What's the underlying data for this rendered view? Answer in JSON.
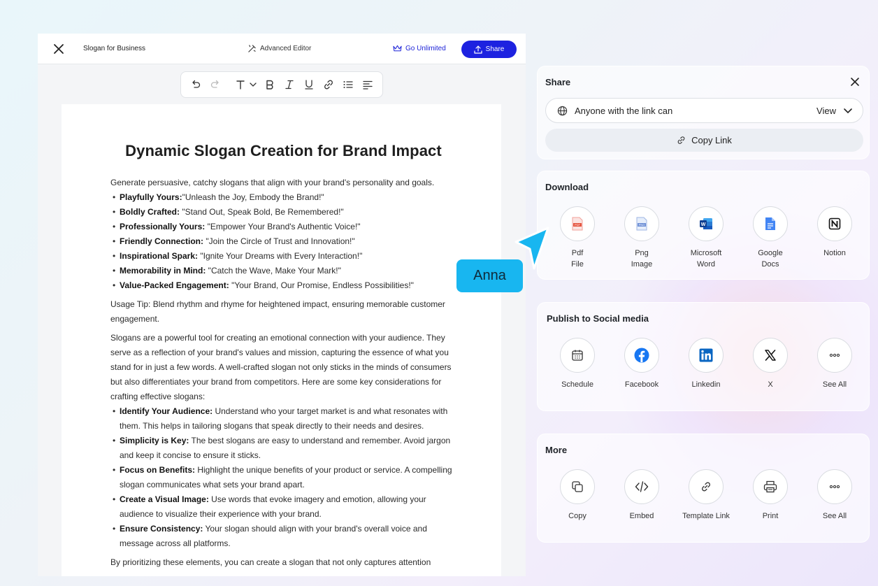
{
  "editor": {
    "doc_title": "Slogan for Business",
    "advanced_editor": "Advanced Editor",
    "go_unlimited": "Go Unlimited",
    "share_label": "Share",
    "toolbar": [
      "undo-icon",
      "redo-icon",
      "text-size-icon",
      "chevron-down-icon",
      "bold-icon",
      "italic-icon",
      "underline-icon",
      "link-icon",
      "list-icon",
      "align-left-icon"
    ]
  },
  "document": {
    "title": "Dynamic Slogan Creation for Brand Impact",
    "intro": "Generate persuasive, catchy slogans that align with your brand's personality and goals.",
    "slogans": [
      {
        "label": "Playfully Yours:",
        "text": "\"Unleash the Joy, Embody the Brand!\""
      },
      {
        "label": "Boldly Crafted:",
        "text": " \"Stand Out, Speak Bold, Be Remembered!\""
      },
      {
        "label": "Professionally Yours:",
        "text": " \"Empower Your Brand's Authentic Voice!\""
      },
      {
        "label": "Friendly Connection:",
        "text": " \"Join the Circle of Trust and Innovation!\""
      },
      {
        "label": "Inspirational Spark:",
        "text": " \"Ignite Your Dreams with Every Interaction!\""
      },
      {
        "label": "Memorability in Mind:",
        "text": " \"Catch the Wave, Make Your Mark!\""
      },
      {
        "label": "Value-Packed Engagement:",
        "text": " \"Your Brand, Our Promise, Endless Possibilities!\""
      }
    ],
    "usage_tip": "Usage Tip: Blend rhythm and rhyme for heightened impact, ensuring memorable customer engagement.",
    "paragraph": "Slogans are a powerful tool for creating an emotional connection with your audience. They serve as a reflection of your brand's values and mission, capturing the essence of what you stand for in just a few words. A well-crafted slogan not only sticks in the minds of consumers but also differentiates your brand from competitors. Here are some key considerations for crafting effective slogans:",
    "considerations": [
      {
        "label": "Identify Your Audience:",
        "text": " Understand who your target market is and what resonates with them. This helps in tailoring slogans that speak directly to their needs and desires."
      },
      {
        "label": "Simplicity is Key:",
        "text": " The best slogans are easy to understand and remember. Avoid jargon and keep it concise to ensure it sticks."
      },
      {
        "label": "Focus on Benefits:",
        "text": " Highlight the unique benefits of your product or service. A compelling slogan communicates what sets your brand apart."
      },
      {
        "label": "Create a Visual Image:",
        "text": " Use words that evoke imagery and emotion, allowing your audience to visualize their experience with your brand."
      },
      {
        "label": "Ensure Consistency:",
        "text": " Your slogan should align with your brand's overall voice and message across all platforms."
      }
    ],
    "closing": "By prioritizing these elements, you can create a slogan that not only captures attention"
  },
  "cursor": {
    "name": "Anna",
    "color": "#18b6f0"
  },
  "share": {
    "title": "Share",
    "access": "Anyone with the link can",
    "permission": "View",
    "copy_link": "Copy Link"
  },
  "download": {
    "title": "Download",
    "items": [
      {
        "label": "Pdf\nFile",
        "icon": "pdf-icon"
      },
      {
        "label": "Png\nImage",
        "icon": "png-icon"
      },
      {
        "label": "Microsoft\nWord",
        "icon": "word-icon"
      },
      {
        "label": "Google\nDocs",
        "icon": "google-docs-icon"
      },
      {
        "label": "Notion",
        "icon": "notion-icon"
      }
    ]
  },
  "social": {
    "title": "Publish to Social media",
    "items": [
      {
        "label": "Schedule",
        "icon": "calendar-icon"
      },
      {
        "label": "Facebook",
        "icon": "facebook-icon"
      },
      {
        "label": "Linkedin",
        "icon": "linkedin-icon"
      },
      {
        "label": "X",
        "icon": "x-icon"
      },
      {
        "label": "See All",
        "icon": "more-icon"
      }
    ]
  },
  "more": {
    "title": "More",
    "items": [
      {
        "label": "Copy",
        "icon": "copy-icon"
      },
      {
        "label": "Embed",
        "icon": "embed-icon"
      },
      {
        "label": "Template Link",
        "icon": "template-link-icon"
      },
      {
        "label": "Print",
        "icon": "print-icon"
      },
      {
        "label": "See All",
        "icon": "more-icon"
      }
    ]
  },
  "colors": {
    "brand_blue": "#1d22e0",
    "cursor_blue": "#18b6f0"
  }
}
